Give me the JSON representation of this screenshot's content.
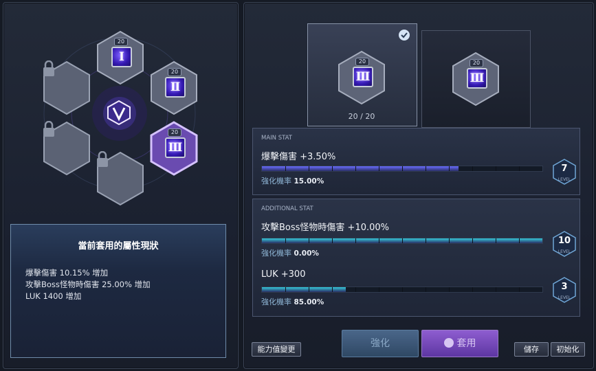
{
  "core": {
    "slots": [
      {
        "name": "core-slot-1",
        "level": "20",
        "numeral": "Ⅰ",
        "locked": false
      },
      {
        "name": "core-slot-2",
        "level": "20",
        "numeral": "Ⅱ",
        "locked": false
      },
      {
        "name": "core-slot-3",
        "level": "20",
        "numeral": "Ⅲ",
        "locked": false,
        "selected": true
      },
      {
        "name": "core-slot-4",
        "locked": true
      },
      {
        "name": "core-slot-5",
        "locked": true
      },
      {
        "name": "core-slot-6",
        "locked": true
      }
    ]
  },
  "current": {
    "title": "當前套用的屬性現狀",
    "lines": [
      "爆擊傷害 10.15% 增加",
      "攻擊Boss怪物時傷害 25.00% 增加",
      "LUK 1400 增加"
    ]
  },
  "preview": {
    "level_a": "20",
    "numeral_a": "Ⅲ",
    "level_b": "20",
    "numeral_b": "Ⅲ",
    "count": "20 / 20"
  },
  "main_stat": {
    "label": "MAIN STAT",
    "stat": "爆擊傷害 +3.50%",
    "rate_label": "強化機率",
    "rate_value": "15.00%",
    "level": "7",
    "level_label": "LEVEL",
    "progress": 0.7
  },
  "additional_stat": {
    "label": "ADDITIONAL STAT",
    "items": [
      {
        "stat": "攻擊Boss怪物時傷害 +10.00%",
        "rate_label": "強化機率",
        "rate_value": "0.00%",
        "level": "10",
        "level_label": "LEVEL",
        "progress": 1.0
      },
      {
        "stat": "LUK +300",
        "rate_label": "強化機率",
        "rate_value": "85.00%",
        "level": "3",
        "level_label": "LEVEL",
        "progress": 0.3
      }
    ]
  },
  "buttons": {
    "stats": "能力值變更",
    "enhance": "強化",
    "apply": "套用",
    "save": "儲存",
    "reset": "初始化"
  },
  "colors": {
    "main_bar": "#6a6cff",
    "add_bar": "#35c9d9",
    "accent_purple": "#8e5dd0"
  }
}
